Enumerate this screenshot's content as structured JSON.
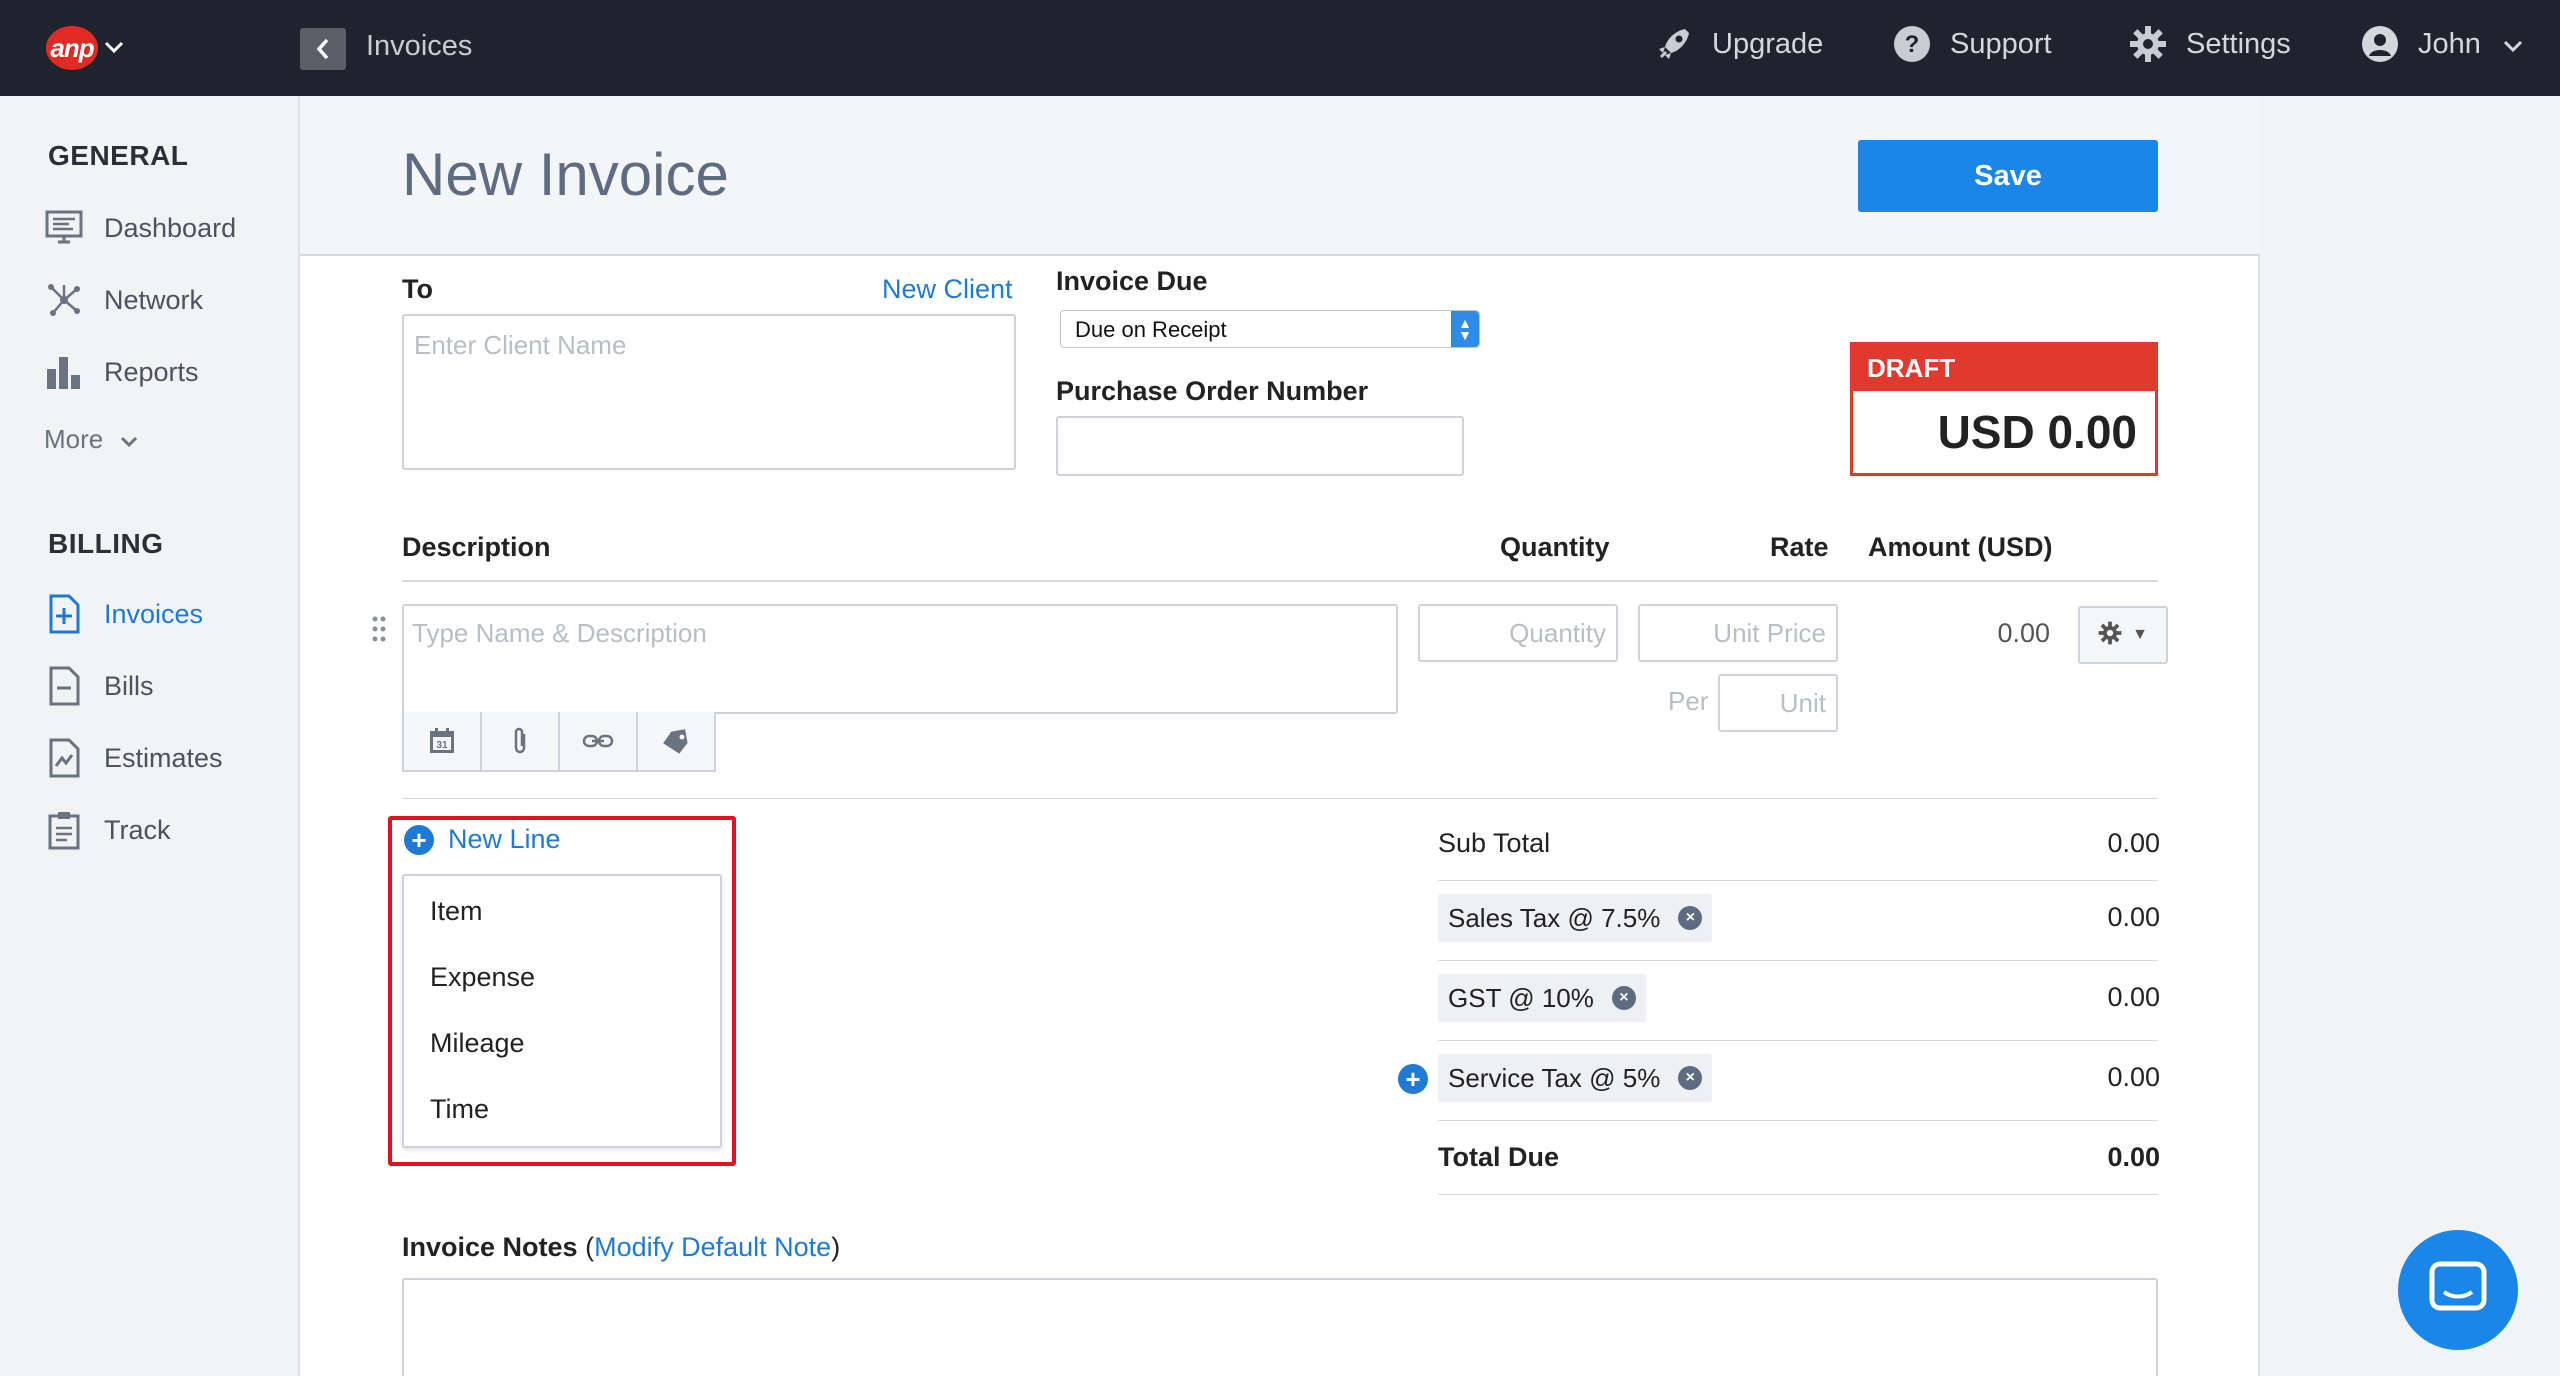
{
  "topbar": {
    "logo_text": "anp",
    "breadcrumb": "Invoices",
    "upgrade": "Upgrade",
    "support": "Support",
    "settings": "Settings",
    "user": "John"
  },
  "sidebar": {
    "general_heading": "GENERAL",
    "general_items": [
      "Dashboard",
      "Network",
      "Reports"
    ],
    "more": "More",
    "billing_heading": "BILLING",
    "billing_items": [
      "Invoices",
      "Bills",
      "Estimates",
      "Track"
    ],
    "active_item": "Invoices"
  },
  "page": {
    "title": "New Invoice",
    "save_label": "Save"
  },
  "client": {
    "label": "To",
    "new_client": "New Client",
    "placeholder": "Enter Client Name"
  },
  "invoice_due": {
    "label": "Invoice Due",
    "selected": "Due on Receipt"
  },
  "po": {
    "label": "Purchase Order Number"
  },
  "status": {
    "tag": "DRAFT",
    "amount": "USD 0.00"
  },
  "lines": {
    "headers": {
      "description": "Description",
      "quantity": "Quantity",
      "rate": "Rate",
      "amount": "Amount (USD)"
    },
    "desc_placeholder": "Type Name & Description",
    "qty_placeholder": "Quantity",
    "price_placeholder": "Unit Price",
    "per_label": "Per",
    "unit_placeholder": "Unit",
    "line_amount": "0.00"
  },
  "new_line": {
    "label": "New Line",
    "options": [
      "Item",
      "Expense",
      "Mileage",
      "Time"
    ]
  },
  "totals": {
    "subtotal_label": "Sub Total",
    "subtotal": "0.00",
    "taxes": [
      {
        "label": "Sales Tax @ 7.5%",
        "value": "0.00"
      },
      {
        "label": "GST @ 10%",
        "value": "0.00"
      },
      {
        "label": "Service Tax @ 5%",
        "value": "0.00"
      }
    ],
    "total_label": "Total Due",
    "total": "0.00"
  },
  "notes": {
    "label": "Invoice Notes",
    "open_paren": "(",
    "modify_link": "Modify Default Note",
    "close_paren": ")"
  },
  "colors": {
    "topbar": "#1f232d",
    "accent": "#1a86e8",
    "draft_red": "#e03a2f",
    "highlight_red": "#e3121c"
  }
}
